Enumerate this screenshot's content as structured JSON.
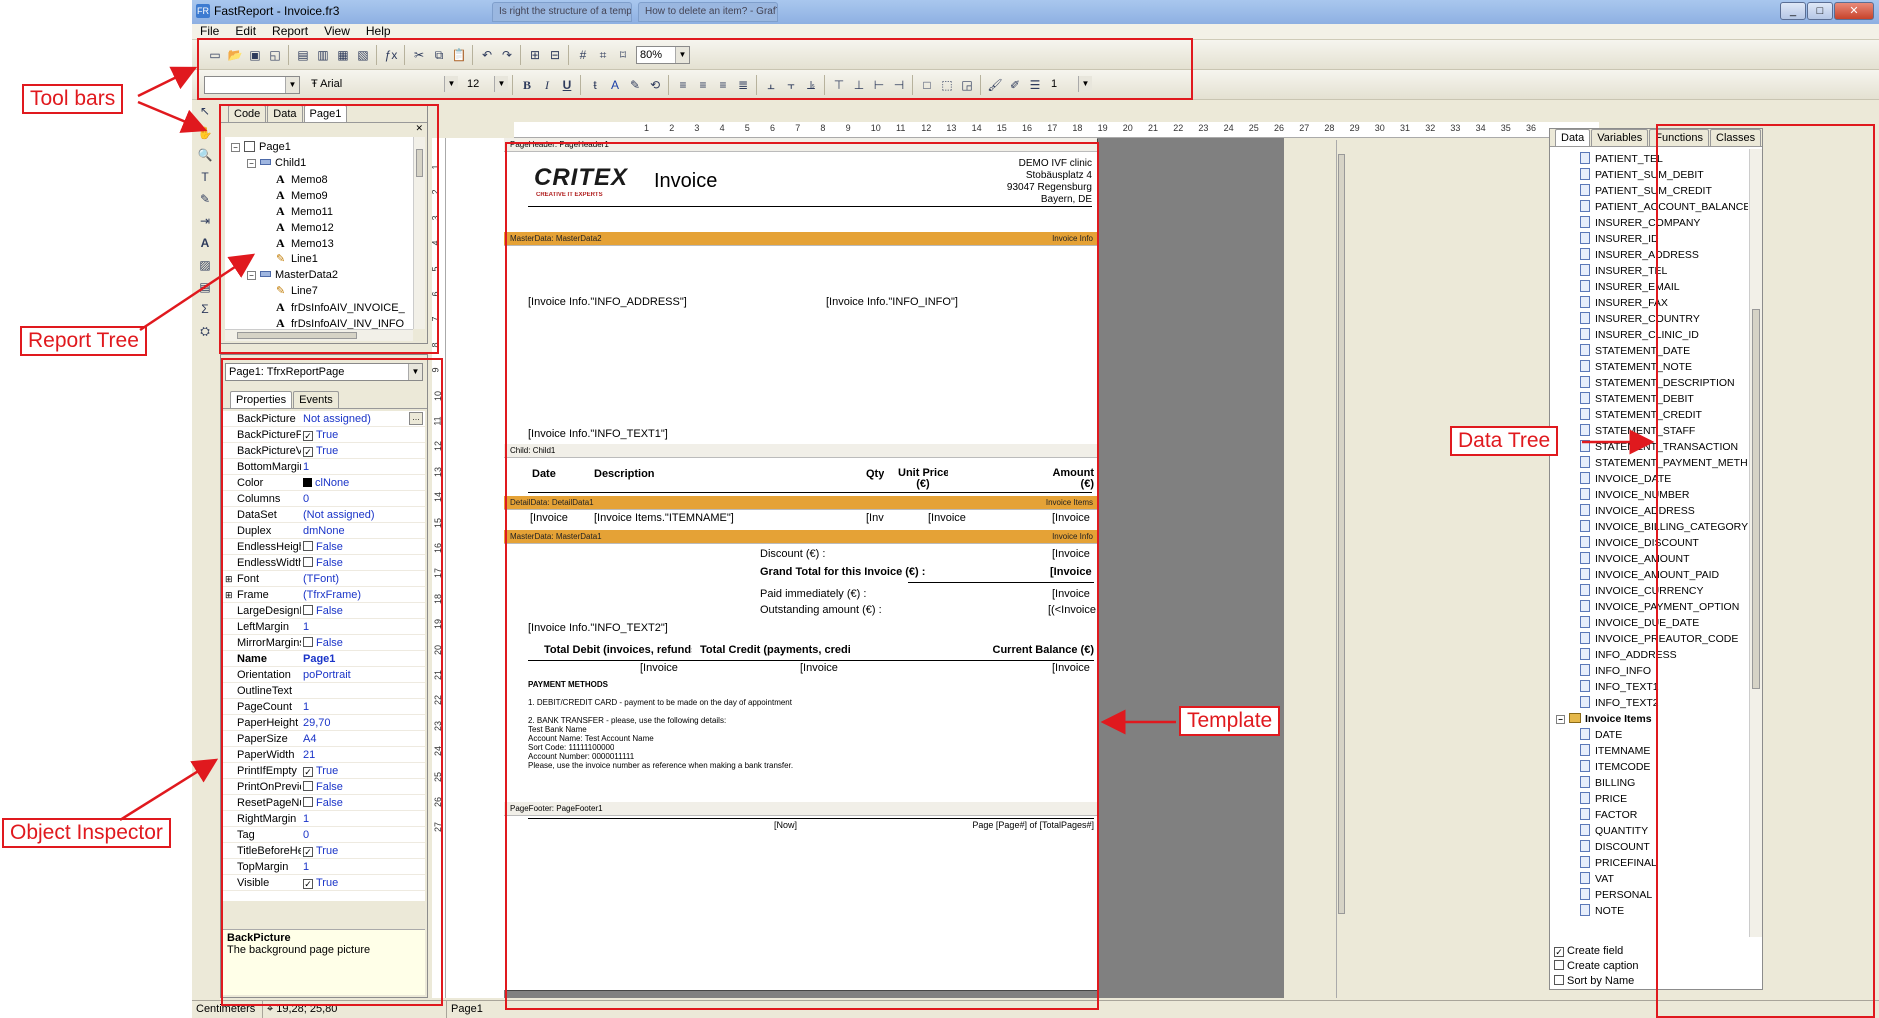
{
  "window": {
    "title": "FastReport - Invoice.fr3",
    "ghost_tabs": [
      "Is right the structure of a template",
      "How to delete an item? - GrafTV"
    ],
    "buttons": {
      "minimize": "_",
      "maximize": "□",
      "close": "✕"
    }
  },
  "menu": [
    "File",
    "Edit",
    "Report",
    "View",
    "Help"
  ],
  "toolbar": {
    "zoom": "80%",
    "font_name": "Arial",
    "font_size": "12",
    "style_combo": "",
    "line_width": "1",
    "bold": "B",
    "italic": "I",
    "underline": "U"
  },
  "report_tree": {
    "tabs": [
      "Code",
      "Data",
      "Page1"
    ],
    "active_tab": "Page1",
    "nodes": [
      {
        "label": "Page1",
        "depth": 0,
        "kind": "page",
        "expand": "−"
      },
      {
        "label": "Child1",
        "depth": 1,
        "kind": "band",
        "expand": "−"
      },
      {
        "label": "Memo8",
        "depth": 2,
        "kind": "memo"
      },
      {
        "label": "Memo9",
        "depth": 2,
        "kind": "memo"
      },
      {
        "label": "Memo11",
        "depth": 2,
        "kind": "memo"
      },
      {
        "label": "Memo12",
        "depth": 2,
        "kind": "memo"
      },
      {
        "label": "Memo13",
        "depth": 2,
        "kind": "memo"
      },
      {
        "label": "Line1",
        "depth": 2,
        "kind": "line"
      },
      {
        "label": "MasterData2",
        "depth": 1,
        "kind": "band",
        "expand": "−"
      },
      {
        "label": "Line7",
        "depth": 2,
        "kind": "line"
      },
      {
        "label": "frDsInfoAIV_INVOICE_",
        "depth": 2,
        "kind": "memo"
      },
      {
        "label": "frDsInfoAIV_INV_INFO",
        "depth": 2,
        "kind": "memo"
      }
    ]
  },
  "inspector": {
    "object_combo": "Page1: TfrxReportPage",
    "tabs": [
      "Properties",
      "Events"
    ],
    "properties": [
      {
        "name": "BackPicture",
        "value": "Not assigned)",
        "checkbox": false,
        "ellipsis": true
      },
      {
        "name": "BackPicturePr",
        "value": "True",
        "checkbox": true,
        "checked": true
      },
      {
        "name": "BackPictureVi",
        "value": "True",
        "checkbox": true,
        "checked": true
      },
      {
        "name": "BottomMargin",
        "value": "1"
      },
      {
        "name": "Color",
        "value": "clNone",
        "swatch": "#000000"
      },
      {
        "name": "Columns",
        "value": "0"
      },
      {
        "name": "DataSet",
        "value": "(Not assigned)"
      },
      {
        "name": "Duplex",
        "value": "dmNone"
      },
      {
        "name": "EndlessHeigh",
        "value": "False",
        "checkbox": true,
        "checked": false
      },
      {
        "name": "EndlessWidth",
        "value": "False",
        "checkbox": true,
        "checked": false
      },
      {
        "name": "Font",
        "value": "(TFont)",
        "expand": true
      },
      {
        "name": "Frame",
        "value": "(TfrxFrame)",
        "expand": true
      },
      {
        "name": "LargeDesignH",
        "value": "False",
        "checkbox": true,
        "checked": false
      },
      {
        "name": "LeftMargin",
        "value": "1"
      },
      {
        "name": "MirrorMargins",
        "value": "False",
        "checkbox": true,
        "checked": false
      },
      {
        "name": "Name",
        "value": "Page1",
        "bold": true
      },
      {
        "name": "Orientation",
        "value": "poPortrait"
      },
      {
        "name": "OutlineText",
        "value": ""
      },
      {
        "name": "PageCount",
        "value": "1"
      },
      {
        "name": "PaperHeight",
        "value": "29,70"
      },
      {
        "name": "PaperSize",
        "value": "A4"
      },
      {
        "name": "PaperWidth",
        "value": "21"
      },
      {
        "name": "PrintIfEmpty",
        "value": "True",
        "checkbox": true,
        "checked": true
      },
      {
        "name": "PrintOnPrevio",
        "value": "False",
        "checkbox": true,
        "checked": false
      },
      {
        "name": "ResetPageNu",
        "value": "False",
        "checkbox": true,
        "checked": false
      },
      {
        "name": "RightMargin",
        "value": "1"
      },
      {
        "name": "Tag",
        "value": "0"
      },
      {
        "name": "TitleBeforeHe",
        "value": "True",
        "checkbox": true,
        "checked": true
      },
      {
        "name": "TopMargin",
        "value": "1"
      },
      {
        "name": "Visible",
        "value": "True",
        "checkbox": true,
        "checked": true
      }
    ],
    "help_title": "BackPicture",
    "help_text": "The background page picture"
  },
  "ruler": {
    "h_ticks": [
      "1",
      "2",
      "3",
      "4",
      "5",
      "6",
      "7",
      "8",
      "9",
      "10",
      "11",
      "12",
      "13",
      "14",
      "15",
      "16",
      "17",
      "18",
      "19",
      "20",
      "21",
      "22",
      "23",
      "24",
      "25",
      "26",
      "27",
      "28",
      "29",
      "30",
      "31",
      "32",
      "33",
      "34",
      "35",
      "36"
    ],
    "v_ticks": [
      "1",
      "2",
      "3",
      "4",
      "5",
      "6",
      "7",
      "8",
      "9",
      "10",
      "11",
      "12",
      "13",
      "14",
      "15",
      "16",
      "17",
      "18",
      "19",
      "20",
      "21",
      "22",
      "23",
      "24",
      "25",
      "26",
      "27"
    ]
  },
  "template": {
    "page_header_band": "PageHeader:",
    "page_header_name": "PageHeader1",
    "logo": "CRITEX",
    "logo_tag": "CREATIVE IT EXPERTS",
    "invoice_title": "Invoice",
    "address_lines": [
      "DEMO IVF clinic",
      "Stobäusplatz 4",
      "93047 Regensburg",
      "Bayern, DE"
    ],
    "master2_band": "MasterData:",
    "master2_name": "MasterData2",
    "master2_ds": "Invoice Info",
    "info_address": "[Invoice Info.\"INFO_ADDRESS\"]",
    "info_info": "[Invoice Info.\"INFO_INFO\"]",
    "info_text1": "[Invoice Info.\"INFO_TEXT1\"]",
    "child_band": "Child:",
    "child_name": "Child1",
    "col_date": "Date",
    "col_description": "Description",
    "col_qty": "Qty",
    "col_unit_price": "Unit Price",
    "col_unit_price2": "(€)",
    "col_amount": "Amount",
    "col_amount2": "(€)",
    "detail_band": "DetailData:",
    "detail_name": "DetailData1",
    "detail_ds": "Invoice Items",
    "detail_date": "[Invoice",
    "detail_desc": "[Invoice Items.\"ITEMNAME\"]",
    "detail_qty": "[Inv",
    "detail_price": "[Invoice",
    "detail_amount": "[Invoice",
    "master1_band": "MasterData:",
    "master1_name": "MasterData1",
    "master1_ds": "Invoice Info",
    "discount": "Discount (€) :",
    "discount_val": "[Invoice",
    "grand_total": "Grand Total for this Invoice (€) :",
    "grand_total_val": "[Invoice",
    "paid": "Paid immediately (€) :",
    "paid_val": "[Invoice",
    "outstanding": "Outstanding amount (€) :",
    "outstanding_val": "[(<Invoice",
    "info_text2": "[Invoice Info.\"INFO_TEXT2\"]",
    "total_debit": "Total Debit (invoices, refunds)",
    "total_credit": "Total Credit (payments, credits)",
    "current_balance": "Current Balance (€)",
    "debit_val": "[Invoice",
    "credit_val": "[Invoice",
    "balance_val": "[Invoice",
    "payment_methods": "PAYMENT METHODS",
    "pm1": "1. DEBIT/CREDIT CARD - payment to be made on the day of appointment",
    "pm2": "2. BANK TRANSFER - please, use the following details:",
    "pm3": "Test Bank Name",
    "pm4": "Account Name: Test Account Name",
    "pm5": "Sort Code: 11111100000",
    "pm6": "Account Number: 0000011111",
    "pm7": "Please, use the invoice number as reference when making a bank transfer.",
    "footer_band": "PageFooter:",
    "footer_name": "PageFooter1",
    "footer_now": "[Now]",
    "footer_page": "Page [Page#] of [TotalPages#]"
  },
  "data_tree": {
    "tabs": [
      "Data",
      "Variables",
      "Functions",
      "Classes"
    ],
    "active_tab": "Data",
    "fields1": [
      "PATIENT_TEL",
      "PATIENT_SUM_DEBIT",
      "PATIENT_SUM_CREDIT",
      "PATIENT_ACCOUNT_BALANCE",
      "INSURER_COMPANY",
      "INSURER_ID",
      "INSURER_ADDRESS",
      "INSURER_TEL",
      "INSURER_EMAIL",
      "INSURER_FAX",
      "INSURER_COUNTRY",
      "INSURER_CLINIC_ID",
      "STATEMENT_DATE",
      "STATEMENT_NOTE",
      "STATEMENT_DESCRIPTION",
      "STATEMENT_DEBIT",
      "STATEMENT_CREDIT",
      "STATEMENT_STAFF",
      "STATEMENT_TRANSACTION",
      "STATEMENT_PAYMENT_METHOD",
      "INVOICE_DATE",
      "INVOICE_NUMBER",
      "INVOICE_ADDRESS",
      "INVOICE_BILLING_CATEGORY",
      "INVOICE_DISCOUNT",
      "INVOICE_AMOUNT",
      "INVOICE_AMOUNT_PAID",
      "INVOICE_CURRENCY",
      "INVOICE_PAYMENT_OPTION",
      "INVOICE_DUE_DATE",
      "INVOICE_PREAUTOR_CODE",
      "INFO_ADDRESS",
      "INFO_INFO",
      "INFO_TEXT1",
      "INFO_TEXT2"
    ],
    "group": "Invoice Items",
    "fields2": [
      "DATE",
      "ITEMNAME",
      "ITEMCODE",
      "BILLING",
      "PRICE",
      "FACTOR",
      "QUANTITY",
      "DISCOUNT",
      "PRICEFINAL",
      "VAT",
      "PERSONAL",
      "NOTE"
    ],
    "options": [
      {
        "label": "Create field",
        "checked": true
      },
      {
        "label": "Create caption",
        "checked": false
      },
      {
        "label": "Sort by Name",
        "checked": false
      }
    ]
  },
  "status": {
    "units": "Centimeters",
    "coords": "19,28; 25,80",
    "page": "Page1"
  },
  "annotations": {
    "toolbars": "Tool bars",
    "report_tree": "Report Tree",
    "object_inspector": "Object Inspector",
    "template": "Template",
    "data_tree": "Data Tree"
  },
  "colors": {
    "annotation": "#e0191e",
    "band_orange": "#e5a236"
  }
}
